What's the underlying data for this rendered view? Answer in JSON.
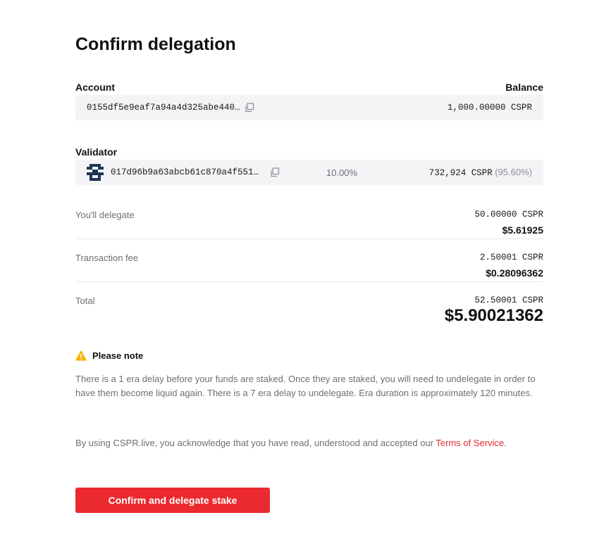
{
  "title": "Confirm delegation",
  "account": {
    "heading": "Account",
    "balance_heading": "Balance",
    "address": "0155df5e9eaf7a94a4d325abe440…",
    "balance": "1,000.00000 CSPR"
  },
  "validator": {
    "heading": "Validator",
    "address": "017d96b9a63abcb61c870a4f551…",
    "commission": "10.00%",
    "stake": "732,924 CSPR",
    "stake_share": "(95.60%)"
  },
  "summary": {
    "delegate": {
      "label": "You'll delegate",
      "amount": "50.00000 CSPR",
      "usd": "$5.61925"
    },
    "fee": {
      "label": "Transaction fee",
      "amount": "2.50001 CSPR",
      "usd": "$0.28096362"
    },
    "total": {
      "label": "Total",
      "amount": "52.50001 CSPR",
      "usd": "$5.90021362"
    }
  },
  "note": {
    "title": "Please note",
    "icon": "warning-icon",
    "text": "There is a 1 era delay before your funds are staked. Once they are staked, you will need to undelegate in order to have them become liquid again. There is a 7 era delay to undelegate. Era duration is approximately 120 minutes."
  },
  "acknowledgement": {
    "prefix": "By using CSPR.live, you acknowledge that you have read, understood and accepted our ",
    "link": "Terms of Service",
    "suffix": "."
  },
  "confirm_button": "Confirm and delegate stake",
  "colors": {
    "accent": "#ea2a2f",
    "warning": "#f5b400",
    "bar_bg": "#f3f4f6"
  }
}
